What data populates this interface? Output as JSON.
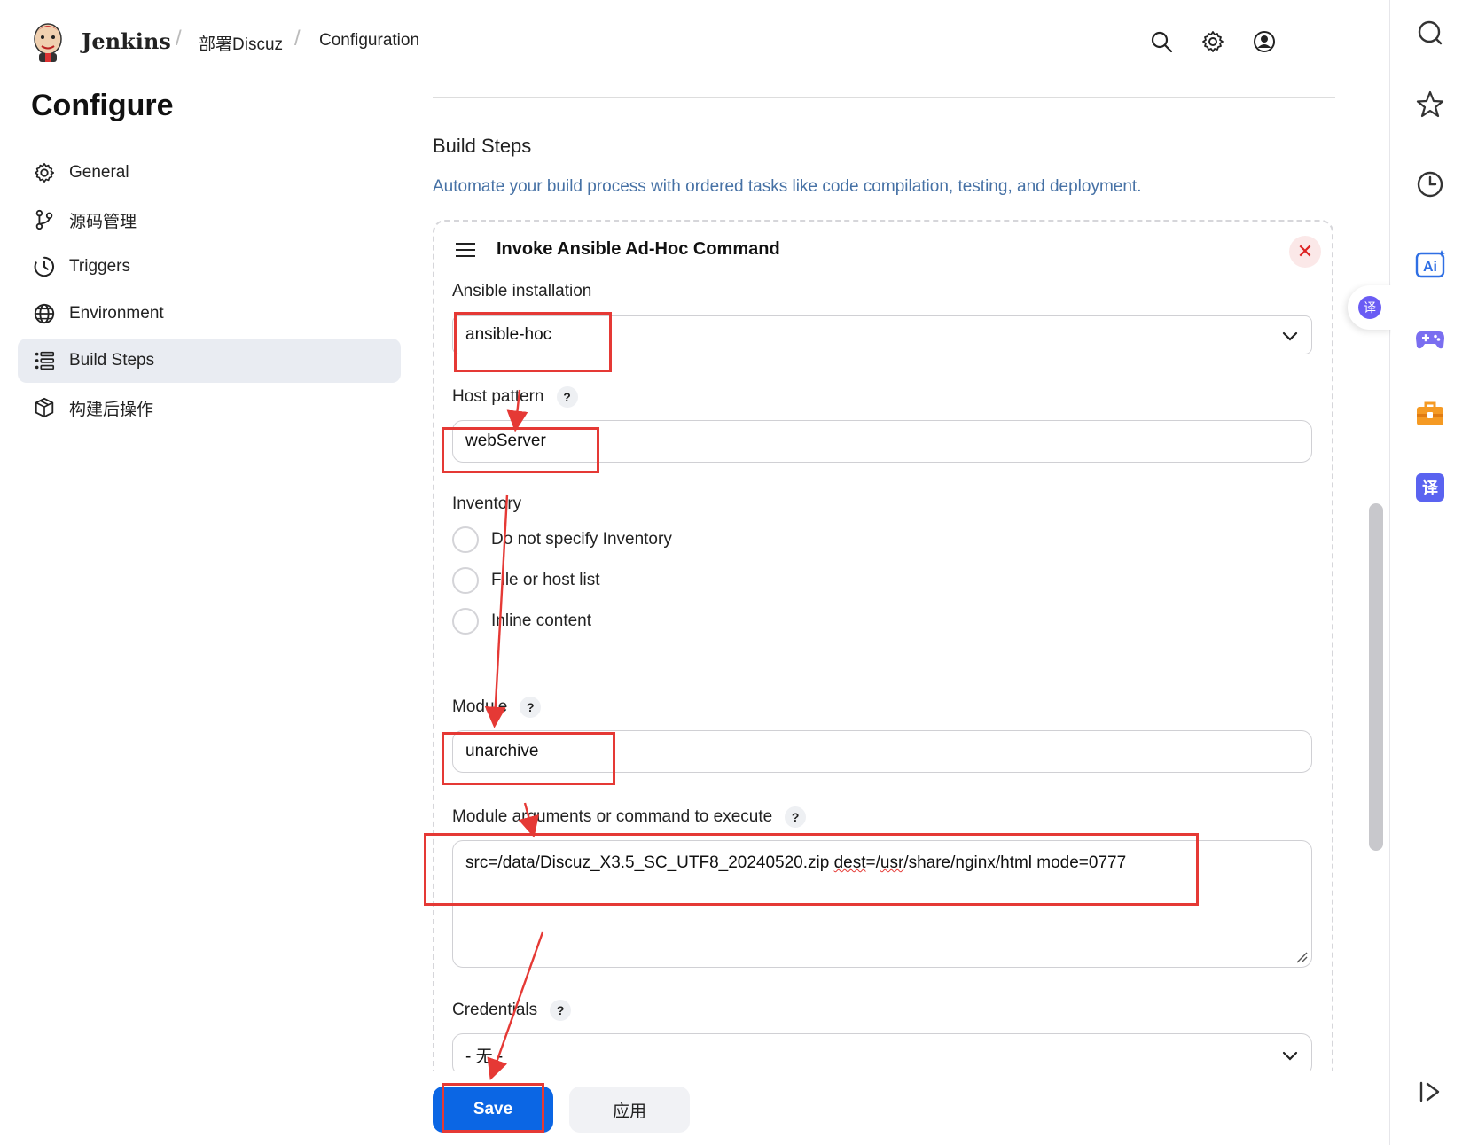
{
  "header": {
    "brand": "Jenkins",
    "breadcrumbs": [
      "部署Discuz",
      "Configuration"
    ],
    "separator": "/",
    "icons": [
      "search-icon",
      "gear-icon",
      "user-icon"
    ]
  },
  "page": {
    "title": "Configure"
  },
  "sidebar": {
    "items": [
      {
        "label": "General",
        "icon": "gear-icon",
        "active": false
      },
      {
        "label": "源码管理",
        "icon": "branch-icon",
        "active": false
      },
      {
        "label": "Triggers",
        "icon": "clock-icon",
        "active": false
      },
      {
        "label": "Environment",
        "icon": "globe-icon",
        "active": false
      },
      {
        "label": "Build Steps",
        "icon": "list-icon",
        "active": true
      },
      {
        "label": "构建后操作",
        "icon": "package-icon",
        "active": false
      }
    ]
  },
  "section": {
    "title": "Build Steps",
    "description": "Automate your build process with ordered tasks like code compilation, testing, and deployment."
  },
  "step": {
    "title": "Invoke Ansible Ad-Hoc Command",
    "close_symbol": "✕",
    "ansible_installation": {
      "label": "Ansible installation",
      "value": "ansible-hoc"
    },
    "host_pattern": {
      "label": "Host pattern",
      "value": "webServer"
    },
    "inventory": {
      "label": "Inventory",
      "options": [
        "Do not specify Inventory",
        "File or host list",
        "Inline content"
      ]
    },
    "module": {
      "label": "Module",
      "value": "unarchive"
    },
    "module_args": {
      "label": "Module arguments or command to execute",
      "value_parts": [
        "src=/data/Discuz_X3.5_SC_UTF8_20240520.zip ",
        "dest",
        "=/",
        "usr",
        "/share/nginx/html mode=0777"
      ]
    },
    "credentials": {
      "label": "Credentials",
      "value": "- 无 -"
    },
    "help_symbol": "?"
  },
  "actions": {
    "save": "Save",
    "apply": "应用"
  },
  "floating": {
    "translate_badge": "译"
  },
  "right_toolbar": {
    "icons": [
      "search-icon",
      "star-icon",
      "history-icon",
      "ai-icon",
      "game-icon",
      "toolbox-icon",
      "translate-icon",
      "collapse-panel-icon"
    ],
    "ai_label": "Ai",
    "translate_label": "译"
  },
  "colors": {
    "accent": "#0b66e4",
    "description": "#4671a5",
    "annotation": "#e53935",
    "active_nav": "#e9ecf2"
  }
}
